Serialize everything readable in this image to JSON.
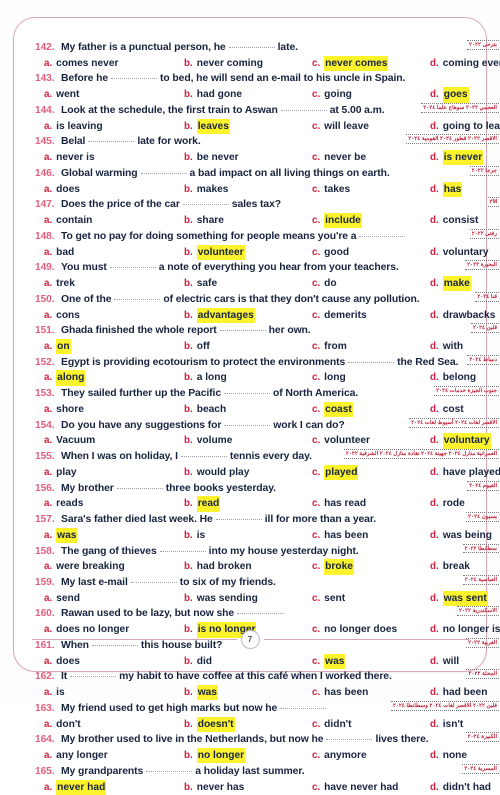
{
  "page": {
    "page_number": "7",
    "accent_frame_color": "#d9a8b6",
    "question_number_color": "#e2607f",
    "option_letter_color": "#d3203f",
    "body_text_color": "#18243f",
    "highlight_color": "#fcf32c",
    "annotation_color": "#c2243c"
  },
  "questions": [
    {
      "number": "142.",
      "stem_before": "My father is a punctual person, he",
      "stem_after": "late.",
      "tag": "بترحى ٢٠٢٢",
      "options": [
        {
          "letter": "a.",
          "text": "comes never",
          "highlighted": false
        },
        {
          "letter": "b.",
          "text": "never coming",
          "highlighted": false
        },
        {
          "letter": "c.",
          "text": "never comes",
          "highlighted": true
        },
        {
          "letter": "d.",
          "text": "coming ever",
          "highlighted": false
        }
      ]
    },
    {
      "number": "143.",
      "stem_before": "Before he",
      "stem_after": "to bed, he will send an e-mail to his uncle in Spain.",
      "tag": "",
      "options": [
        {
          "letter": "a.",
          "text": "went",
          "highlighted": false
        },
        {
          "letter": "b.",
          "text": "had gone",
          "highlighted": false
        },
        {
          "letter": "c.",
          "text": "going",
          "highlighted": false
        },
        {
          "letter": "d.",
          "text": "goes",
          "highlighted": true
        }
      ]
    },
    {
      "number": "144.",
      "stem_before": "Look at the schedule, the first train to Aswan",
      "stem_after": "at 5.00 a.m.",
      "tag": "العجمي ٢٠٢٢ سوهاج علما ٢٠٢٤",
      "options": [
        {
          "letter": "a.",
          "text": "is leaving",
          "highlighted": false
        },
        {
          "letter": "b.",
          "text": "leaves",
          "highlighted": true
        },
        {
          "letter": "c.",
          "text": "will leave",
          "highlighted": false
        },
        {
          "letter": "d.",
          "text": "going to leave",
          "highlighted": false
        }
      ]
    },
    {
      "number": "145.",
      "stem_before": "Belal",
      "stem_after": "late for work.",
      "tag": "الاقصر ٢٠٢٢ قطور ٢٠٢٤ القومية ٢٠٢٤",
      "options": [
        {
          "letter": "a.",
          "text": "never is",
          "highlighted": false
        },
        {
          "letter": "b.",
          "text": "be never",
          "highlighted": false
        },
        {
          "letter": "c.",
          "text": "never be",
          "highlighted": false
        },
        {
          "letter": "d.",
          "text": "is never",
          "highlighted": true
        }
      ]
    },
    {
      "number": "146.",
      "stem_before": "Global warming",
      "stem_after": "a bad impact on all living things on earth.",
      "tag": "جرجا ٢٠٢٢",
      "options": [
        {
          "letter": "a.",
          "text": "does",
          "highlighted": false
        },
        {
          "letter": "b.",
          "text": "makes",
          "highlighted": false
        },
        {
          "letter": "c.",
          "text": "takes",
          "highlighted": false
        },
        {
          "letter": "d.",
          "text": "has",
          "highlighted": true
        }
      ]
    },
    {
      "number": "147.",
      "stem_before": "Does the price of the car",
      "stem_after": "sales tax?",
      "tag": "٢M",
      "options": [
        {
          "letter": "a.",
          "text": "contain",
          "highlighted": false
        },
        {
          "letter": "b.",
          "text": "share",
          "highlighted": false
        },
        {
          "letter": "c.",
          "text": "include",
          "highlighted": true
        },
        {
          "letter": "d.",
          "text": "consist",
          "highlighted": false
        }
      ]
    },
    {
      "number": "148.",
      "stem_before": "To get no pay for doing something for people means you're a",
      "stem_after": "",
      "tag": "رفتى ٢٠٢٢",
      "options": [
        {
          "letter": "a.",
          "text": "bad",
          "highlighted": false
        },
        {
          "letter": "b.",
          "text": "volunteer",
          "highlighted": true
        },
        {
          "letter": "c.",
          "text": "good",
          "highlighted": false
        },
        {
          "letter": "d.",
          "text": "voluntary",
          "highlighted": false
        }
      ]
    },
    {
      "number": "149.",
      "stem_before": "You must",
      "stem_after": "a note of everything you hear from your teachers.",
      "tag": "البحيرة ٢٠٢٢",
      "options": [
        {
          "letter": "a.",
          "text": "trek",
          "highlighted": false
        },
        {
          "letter": "b.",
          "text": "safe",
          "highlighted": false
        },
        {
          "letter": "c.",
          "text": "do",
          "highlighted": false
        },
        {
          "letter": "d.",
          "text": "make",
          "highlighted": true
        }
      ]
    },
    {
      "number": "150.",
      "stem_before": "One of the",
      "stem_after": "of electric cars is that they don't cause any pollution.",
      "tag": "قنا ٢٠٢٤",
      "options": [
        {
          "letter": "a.",
          "text": "cons",
          "highlighted": false
        },
        {
          "letter": "b.",
          "text": "advantages",
          "highlighted": true
        },
        {
          "letter": "c.",
          "text": "demerits",
          "highlighted": false
        },
        {
          "letter": "d.",
          "text": "drawbacks",
          "highlighted": false
        }
      ]
    },
    {
      "number": "151.",
      "stem_before": "Ghada finished the whole report",
      "stem_after": "her own.",
      "tag": "قلين ٢٠٢٤",
      "options": [
        {
          "letter": "a.",
          "text": "on",
          "highlighted": true
        },
        {
          "letter": "b.",
          "text": "off",
          "highlighted": false
        },
        {
          "letter": "c.",
          "text": "from",
          "highlighted": false
        },
        {
          "letter": "d.",
          "text": "with",
          "highlighted": false
        }
      ]
    },
    {
      "number": "152.",
      "stem_before": "Egypt is providing ecotourism to protect the environments",
      "stem_after": "the Red Sea.",
      "tag": "دمياط ٢٠٢٤",
      "options": [
        {
          "letter": "a.",
          "text": "along",
          "highlighted": true
        },
        {
          "letter": "b.",
          "text": "a long",
          "highlighted": false
        },
        {
          "letter": "c.",
          "text": "long",
          "highlighted": false
        },
        {
          "letter": "d.",
          "text": "belong",
          "highlighted": false
        }
      ]
    },
    {
      "number": "153.",
      "stem_before": "They sailed further up the Pacific",
      "stem_after": "of North America.",
      "tag": "جنوب الجيزة خدمات ٢٠٢٤",
      "options": [
        {
          "letter": "a.",
          "text": "shore",
          "highlighted": false
        },
        {
          "letter": "b.",
          "text": "beach",
          "highlighted": false
        },
        {
          "letter": "c.",
          "text": "coast",
          "highlighted": true
        },
        {
          "letter": "d.",
          "text": "cost",
          "highlighted": false
        }
      ]
    },
    {
      "number": "154.",
      "stem_before": "Do you have any suggestions for",
      "stem_after": "work I can do?",
      "tag": "الاقصر لغات ٢٠٢٤ أسيوط لغات ٢٠٢٤",
      "options": [
        {
          "letter": "a.",
          "text": "Vacuum",
          "highlighted": false
        },
        {
          "letter": "b.",
          "text": "volume",
          "highlighted": false
        },
        {
          "letter": "c.",
          "text": "volunteer",
          "highlighted": false
        },
        {
          "letter": "d.",
          "text": "voluntary",
          "highlighted": true
        }
      ]
    },
    {
      "number": "155.",
      "stem_before": "When I was on holiday, I",
      "stem_after": "tennis every day.",
      "tag": "العمرانية منازل ٢٠٢٤ جهينة ٢٠٢٤ نقادة منازل ٢٠٢٤ الشرقية ٢٠٢٢",
      "options": [
        {
          "letter": "a.",
          "text": "play",
          "highlighted": false
        },
        {
          "letter": "b.",
          "text": "would play",
          "highlighted": false
        },
        {
          "letter": "c.",
          "text": "played",
          "highlighted": true
        },
        {
          "letter": "d.",
          "text": "have played",
          "highlighted": false
        }
      ]
    },
    {
      "number": "156.",
      "stem_before": "My brother",
      "stem_after": "three books yesterday.",
      "tag": "الفيوم ٢٠٢٤",
      "options": [
        {
          "letter": "a.",
          "text": "reads",
          "highlighted": false
        },
        {
          "letter": "b.",
          "text": "read",
          "highlighted": true
        },
        {
          "letter": "c.",
          "text": "has read",
          "highlighted": false
        },
        {
          "letter": "d.",
          "text": "rode",
          "highlighted": false
        }
      ]
    },
    {
      "number": "157.",
      "stem_before": "Sara's father died last week. He",
      "stem_after": "ill for more than a year.",
      "tag": "يسيون ٢٠٢٤",
      "options": [
        {
          "letter": "a.",
          "text": "was",
          "highlighted": true
        },
        {
          "letter": "b.",
          "text": "is",
          "highlighted": false
        },
        {
          "letter": "c.",
          "text": "has been",
          "highlighted": false
        },
        {
          "letter": "d.",
          "text": "was being",
          "highlighted": false
        }
      ]
    },
    {
      "number": "158.",
      "stem_before": "The gang of thieves",
      "stem_after": "into my house yesterday night.",
      "tag": "سطانطا ٢٠٢٢",
      "options": [
        {
          "letter": "a.",
          "text": "were breaking",
          "highlighted": false
        },
        {
          "letter": "b.",
          "text": "had broken",
          "highlighted": false
        },
        {
          "letter": "c.",
          "text": "broke",
          "highlighted": true
        },
        {
          "letter": "d.",
          "text": "break",
          "highlighted": false
        }
      ]
    },
    {
      "number": "159.",
      "stem_before": "My last e-mail",
      "stem_after": "to six of my friends.",
      "tag": "العباسية ٢٠٢٤",
      "options": [
        {
          "letter": "a.",
          "text": "send",
          "highlighted": false
        },
        {
          "letter": "b.",
          "text": "was sending",
          "highlighted": false
        },
        {
          "letter": "c.",
          "text": "sent",
          "highlighted": false
        },
        {
          "letter": "d.",
          "text": "was sent",
          "highlighted": true
        }
      ]
    },
    {
      "number": "160.",
      "stem_before": "Rawan used to be lazy, but now she",
      "stem_after": "",
      "tag": "الاسكندرية ٢٠٢٢",
      "options": [
        {
          "letter": "a.",
          "text": "does no longer",
          "highlighted": false
        },
        {
          "letter": "b.",
          "text": "is no longer",
          "highlighted": true
        },
        {
          "letter": "c.",
          "text": "no longer does",
          "highlighted": false
        },
        {
          "letter": "d.",
          "text": "no longer is",
          "highlighted": false
        }
      ]
    },
    {
      "number": "161.",
      "stem_before": "When",
      "stem_after": "this house built?",
      "tag": "الغربية ٢٠٢٢",
      "options": [
        {
          "letter": "a.",
          "text": "does",
          "highlighted": false
        },
        {
          "letter": "b.",
          "text": "did",
          "highlighted": false
        },
        {
          "letter": "c.",
          "text": "was",
          "highlighted": true
        },
        {
          "letter": "d.",
          "text": "will",
          "highlighted": false
        }
      ]
    },
    {
      "number": "162.",
      "stem_before": "It",
      "stem_after": "my habit to have coffee at this café when I worked there.",
      "tag": "المحلة ٢٠٢٢",
      "options": [
        {
          "letter": "a.",
          "text": "is",
          "highlighted": false
        },
        {
          "letter": "b.",
          "text": "was",
          "highlighted": true
        },
        {
          "letter": "c.",
          "text": "has been",
          "highlighted": false
        },
        {
          "letter": "d.",
          "text": "had been",
          "highlighted": false
        }
      ]
    },
    {
      "number": "163.",
      "stem_before": "My friend used to get high marks but now he",
      "stem_after": "",
      "tag": "قلين ٢٠٢٢ الاقصر لغات ٢٠٢٤ وسطانطا ٢٠٢٤",
      "options": [
        {
          "letter": "a.",
          "text": "don't",
          "highlighted": false
        },
        {
          "letter": "b.",
          "text": "doesn't",
          "highlighted": true
        },
        {
          "letter": "c.",
          "text": "didn't",
          "highlighted": false
        },
        {
          "letter": "d.",
          "text": "isn't",
          "highlighted": false
        }
      ]
    },
    {
      "number": "164.",
      "stem_before": "My brother used to live in the Netherlands, but now he",
      "stem_after": "lives there.",
      "tag": "الكبيرة ٢٠٢٤",
      "options": [
        {
          "letter": "a.",
          "text": "any longer",
          "highlighted": false
        },
        {
          "letter": "b.",
          "text": "no longer",
          "highlighted": true
        },
        {
          "letter": "c.",
          "text": "anymore",
          "highlighted": false
        },
        {
          "letter": "d.",
          "text": "none",
          "highlighted": false
        }
      ]
    },
    {
      "number": "165.",
      "stem_before": "My grandparents",
      "stem_after": "a holiday last summer.",
      "tag": "المسرية ٢٠٢٤",
      "options": [
        {
          "letter": "a.",
          "text": "never had",
          "highlighted": true
        },
        {
          "letter": "b.",
          "text": "never has",
          "highlighted": false
        },
        {
          "letter": "c.",
          "text": "have never had",
          "highlighted": false
        },
        {
          "letter": "d.",
          "text": "didn't had",
          "highlighted": false
        }
      ]
    }
  ]
}
